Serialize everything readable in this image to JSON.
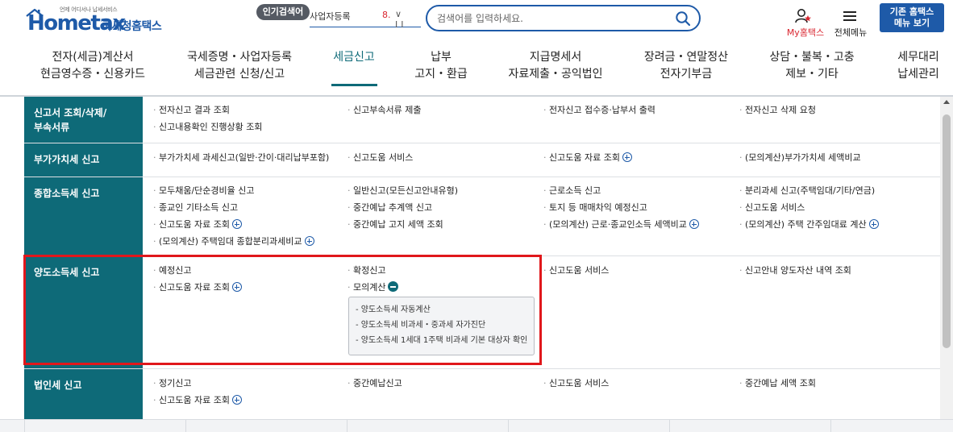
{
  "header": {
    "logo_small": "언제 어디서나 납세서비스",
    "logo_main": "Hometax",
    "logo_sub": "국세청홈택스",
    "popular_label": "인기검색어",
    "rolling_keyword": "사업자등록",
    "rolling_rank": "8.",
    "rolling_controls": "∨ II",
    "search_placeholder": "검색어를 입력하세요.",
    "myhome_label": "My홈택스",
    "allmenu_label": "전체메뉴",
    "oldsite_label_line1": "기존 홈택스",
    "oldsite_label_line2": "메뉴 보기"
  },
  "gnb": {
    "items": [
      {
        "line1": "전자(세금)계산서",
        "line2": "현금영수증・신용카드"
      },
      {
        "line1": "국세증명・사업자등록",
        "line2": "세금관련 신청/신고"
      },
      {
        "line1": "세금신고",
        "line2": ""
      },
      {
        "line1": "납부",
        "line2": "고지・환급"
      },
      {
        "line1": "지급명세서",
        "line2": "자료제출・공익법인"
      },
      {
        "line1": "장려금・연말정산",
        "line2": "전자기부금"
      },
      {
        "line1": "상담・불복・고충",
        "line2": "제보・기타"
      },
      {
        "line1": "세무대리",
        "line2": "납세관리"
      }
    ],
    "active_index": 2
  },
  "menu": {
    "rows": [
      {
        "head": "신고서 조회/삭제/\n부속서류",
        "cells": [
          "전자신고 결과 조회",
          "신고부속서류 제출",
          "전자신고 접수증·납부서 출력",
          "전자신고 삭제 요청",
          "신고내용확인 진행상황 조회"
        ]
      },
      {
        "head": "부가가치세 신고",
        "cells": [
          "부가가치세 과세신고(일반·간이·대리납부포함)",
          "신고도움 서비스",
          "신고도움 자료 조회",
          "(모의계산)부가가치세 세액비교"
        ]
      },
      {
        "head": "종합소득세 신고",
        "cells": [
          "모두채움/단순경비율 신고",
          "일반신고(모든신고안내유형)",
          "근로소득 신고",
          "분리과세 신고(주택임대/기타/연금)",
          "종교인 기타소득 신고",
          "중간예납 추계액 신고",
          "토지 등 매매차익 예정신고",
          "신고도움 서비스",
          "신고도움 자료 조회",
          "중간예납 고지 세액 조회",
          "(모의계산) 근로·종교인소득 세액비교",
          "(모의계산) 주택 간주임대료 계산",
          "(모의계산) 주택임대 종합분리과세비교"
        ]
      },
      {
        "head": "양도소득세 신고",
        "cells": [
          "예정신고",
          "확정신고",
          "신고도움 서비스",
          "신고안내 양도자산 내역 조회",
          "신고도움 자료 조회",
          "모의계산"
        ],
        "submenu": [
          "- 양도소득세 자동계산",
          "- 양도소득세 비과세・중과세 자가진단",
          "- 양도소득세 1세대 1주택 비과세 기본 대상자 확인"
        ]
      },
      {
        "head": "법인세 신고",
        "cells": [
          "정기신고",
          "중간예납신고",
          "신고도움 서비스",
          "중간예납 세액 조회",
          "신고도움 자료 조회"
        ]
      }
    ]
  },
  "colors": {
    "brand_blue": "#1e5aa8",
    "teal": "#0e6a78",
    "highlight_red": "#e0171b",
    "myhome_red": "#d9252f"
  }
}
